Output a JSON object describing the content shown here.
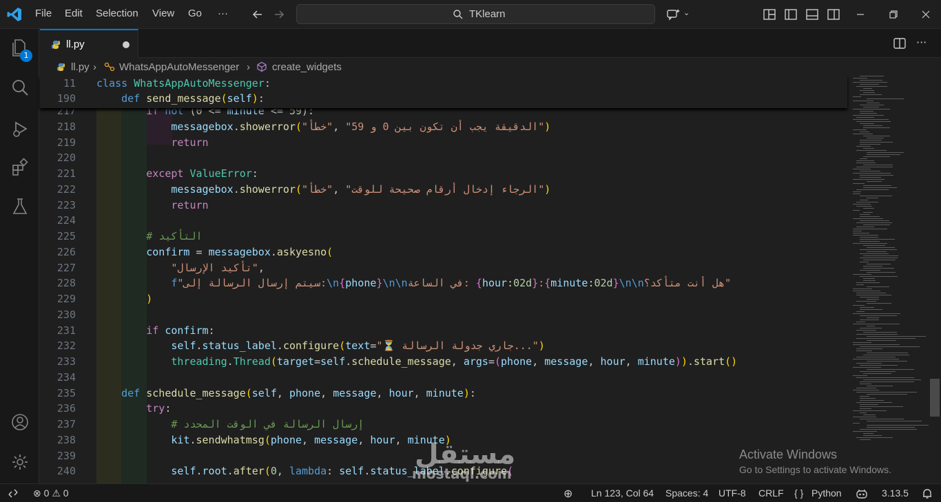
{
  "menu": [
    "File",
    "Edit",
    "Selection",
    "View",
    "Go",
    "···"
  ],
  "search": {
    "label": "TKlearn"
  },
  "activity": {
    "explorer_badge": "1"
  },
  "tab": {
    "label": "ll.py"
  },
  "breadcrumb": {
    "file": "ll.py",
    "class": "WhatsAppAutoMessenger",
    "method": "create_widgets"
  },
  "sticky": [
    {
      "ln": "11",
      "code": [
        [
          "kw",
          "class "
        ],
        [
          "cls",
          "WhatsAppAutoMessenger"
        ],
        [
          "",
          ":"
        ]
      ]
    },
    {
      "ln": "190",
      "code": [
        [
          "",
          "    "
        ],
        [
          "kw",
          "def "
        ],
        [
          "fn",
          "send_message"
        ],
        [
          "br1",
          "("
        ],
        [
          "var",
          "self"
        ],
        [
          "br1",
          ")"
        ],
        [
          "",
          ":"
        ]
      ]
    }
  ],
  "lines": [
    {
      "ln": "217",
      "code": [
        [
          "",
          "        "
        ],
        [
          "kc",
          "if "
        ],
        [
          "kw",
          "not "
        ],
        [
          "",
          "("
        ],
        [
          "num",
          "0"
        ],
        [
          "",
          " <= "
        ],
        [
          "var",
          "minute"
        ],
        [
          "",
          " <= "
        ],
        [
          "num",
          "59"
        ],
        [
          "",
          "):"
        ]
      ]
    },
    {
      "ln": "218",
      "code": [
        [
          "",
          "            "
        ],
        [
          "var",
          "messagebox"
        ],
        [
          "",
          "."
        ],
        [
          "fn",
          "showerror"
        ],
        [
          "br1",
          "("
        ],
        [
          "str",
          "\"خطأ\""
        ],
        [
          "",
          ", "
        ],
        [
          "str",
          "\"الدقيقة يجب أن تكون بين 0 و 59\""
        ],
        [
          "br1",
          ")"
        ]
      ]
    },
    {
      "ln": "219",
      "code": [
        [
          "",
          "            "
        ],
        [
          "kc",
          "return"
        ]
      ]
    },
    {
      "ln": "220",
      "code": []
    },
    {
      "ln": "221",
      "code": [
        [
          "",
          "        "
        ],
        [
          "kc",
          "except "
        ],
        [
          "cls",
          "ValueError"
        ],
        [
          "",
          ":"
        ]
      ]
    },
    {
      "ln": "222",
      "code": [
        [
          "",
          "            "
        ],
        [
          "var",
          "messagebox"
        ],
        [
          "",
          "."
        ],
        [
          "fn",
          "showerror"
        ],
        [
          "br1",
          "("
        ],
        [
          "str",
          "\"خطأ\""
        ],
        [
          "",
          ", "
        ],
        [
          "str",
          "\"الرجاء إدخال أرقام صحيحة للوقت\""
        ],
        [
          "br1",
          ")"
        ]
      ]
    },
    {
      "ln": "223",
      "code": [
        [
          "",
          "            "
        ],
        [
          "kc",
          "return"
        ]
      ]
    },
    {
      "ln": "224",
      "code": []
    },
    {
      "ln": "225",
      "code": [
        [
          "",
          "        "
        ],
        [
          "cmt",
          "# التأكيد"
        ]
      ]
    },
    {
      "ln": "226",
      "code": [
        [
          "",
          "        "
        ],
        [
          "var",
          "confirm"
        ],
        [
          "",
          " = "
        ],
        [
          "var",
          "messagebox"
        ],
        [
          "",
          "."
        ],
        [
          "fn",
          "askyesno"
        ],
        [
          "br1",
          "("
        ]
      ]
    },
    {
      "ln": "227",
      "code": [
        [
          "",
          "            "
        ],
        [
          "str",
          "\"تأكيد الإرسال\""
        ],
        [
          "",
          ","
        ]
      ]
    },
    {
      "ln": "228",
      "code": [
        [
          "",
          "            "
        ],
        [
          "kw",
          "f"
        ],
        [
          "str",
          "\"سيتم إرسال الرسالة إلى:"
        ],
        [
          "kw",
          "\\n"
        ],
        [
          "br2",
          "{"
        ],
        [
          "var",
          "phone"
        ],
        [
          "br2",
          "}"
        ],
        [
          "kw",
          "\\n\\n"
        ],
        [
          "str",
          "في الساعة: "
        ],
        [
          "br2",
          "{"
        ],
        [
          "var",
          "hour"
        ],
        [
          "",
          ":"
        ],
        [
          "num",
          "02d"
        ],
        [
          "br2",
          "}"
        ],
        [
          "str",
          ":"
        ],
        [
          "br2",
          "{"
        ],
        [
          "var",
          "minute"
        ],
        [
          "",
          ":"
        ],
        [
          "num",
          "02d"
        ],
        [
          "br2",
          "}"
        ],
        [
          "kw",
          "\\n\\n"
        ],
        [
          "str",
          "هل أنت متأكد؟\""
        ]
      ]
    },
    {
      "ln": "229",
      "code": [
        [
          "",
          "        "
        ],
        [
          "br1",
          ")"
        ]
      ]
    },
    {
      "ln": "230",
      "code": []
    },
    {
      "ln": "231",
      "code": [
        [
          "",
          "        "
        ],
        [
          "kc",
          "if "
        ],
        [
          "var",
          "confirm"
        ],
        [
          "",
          ":"
        ]
      ]
    },
    {
      "ln": "232",
      "code": [
        [
          "",
          "            "
        ],
        [
          "var",
          "self"
        ],
        [
          "",
          "."
        ],
        [
          "var",
          "status_label"
        ],
        [
          "",
          "."
        ],
        [
          "fn",
          "configure"
        ],
        [
          "br1",
          "("
        ],
        [
          "var",
          "text"
        ],
        [
          "",
          "="
        ],
        [
          "str",
          "\"⏳ جاري جدولة الرسالة...\""
        ],
        [
          "br1",
          ")"
        ]
      ]
    },
    {
      "ln": "233",
      "code": [
        [
          "",
          "            "
        ],
        [
          "cls",
          "threading"
        ],
        [
          "",
          "."
        ],
        [
          "cls",
          "Thread"
        ],
        [
          "br1",
          "("
        ],
        [
          "var",
          "target"
        ],
        [
          "",
          "="
        ],
        [
          "var",
          "self"
        ],
        [
          "",
          "."
        ],
        [
          "fn",
          "schedule_message"
        ],
        [
          "",
          ", "
        ],
        [
          "var",
          "args"
        ],
        [
          "",
          "="
        ],
        [
          "br2",
          "("
        ],
        [
          "var",
          "phone"
        ],
        [
          "",
          ", "
        ],
        [
          "var",
          "message"
        ],
        [
          "",
          ", "
        ],
        [
          "var",
          "hour"
        ],
        [
          "",
          ", "
        ],
        [
          "var",
          "minute"
        ],
        [
          "br2",
          ")"
        ],
        [
          "br1",
          ")"
        ],
        [
          "",
          "."
        ],
        [
          "fn",
          "start"
        ],
        [
          "br1",
          "()"
        ]
      ]
    },
    {
      "ln": "234",
      "code": []
    },
    {
      "ln": "235",
      "code": [
        [
          "",
          "    "
        ],
        [
          "kw",
          "def "
        ],
        [
          "fn",
          "schedule_message"
        ],
        [
          "br1",
          "("
        ],
        [
          "var",
          "self"
        ],
        [
          "",
          ", "
        ],
        [
          "var",
          "phone"
        ],
        [
          "",
          ", "
        ],
        [
          "var",
          "message"
        ],
        [
          "",
          ", "
        ],
        [
          "var",
          "hour"
        ],
        [
          "",
          ", "
        ],
        [
          "var",
          "minute"
        ],
        [
          "br1",
          ")"
        ],
        [
          "",
          ":"
        ]
      ]
    },
    {
      "ln": "236",
      "code": [
        [
          "",
          "        "
        ],
        [
          "kc",
          "try"
        ],
        [
          "",
          ":"
        ]
      ]
    },
    {
      "ln": "237",
      "code": [
        [
          "",
          "            "
        ],
        [
          "cmt",
          "# إرسال الرسالة في الوقت المحدد"
        ]
      ]
    },
    {
      "ln": "238",
      "code": [
        [
          "",
          "            "
        ],
        [
          "var",
          "kit"
        ],
        [
          "",
          "."
        ],
        [
          "fn",
          "sendwhatmsg"
        ],
        [
          "br1",
          "("
        ],
        [
          "var",
          "phone"
        ],
        [
          "",
          ", "
        ],
        [
          "var",
          "message"
        ],
        [
          "",
          ", "
        ],
        [
          "var",
          "hour"
        ],
        [
          "",
          ", "
        ],
        [
          "var",
          "minute"
        ],
        [
          "br1",
          ")"
        ]
      ]
    },
    {
      "ln": "239",
      "code": []
    },
    {
      "ln": "240",
      "code": [
        [
          "",
          "            "
        ],
        [
          "var",
          "self"
        ],
        [
          "",
          "."
        ],
        [
          "var",
          "root"
        ],
        [
          "",
          "."
        ],
        [
          "fn",
          "after"
        ],
        [
          "br1",
          "("
        ],
        [
          "num",
          "0"
        ],
        [
          "",
          ", "
        ],
        [
          "kw",
          "lambda"
        ],
        [
          "",
          ": "
        ],
        [
          "var",
          "self"
        ],
        [
          "",
          "."
        ],
        [
          "var",
          "status_label"
        ],
        [
          "",
          "."
        ],
        [
          "fn",
          "configure"
        ],
        [
          "br2",
          "("
        ]
      ]
    }
  ],
  "watermark": {
    "title": "Activate Windows",
    "subtitle": "Go to Settings to activate Windows.",
    "brand_ar": "مستقل",
    "brand_en": "mostaql.com"
  },
  "status": {
    "errors": "0",
    "warnings": "0",
    "position": "Ln 123, Col 64",
    "spaces": "Spaces: 4",
    "encoding": "UTF-8",
    "eol": "CRLF",
    "language": "Python",
    "version": "3.13.5"
  },
  "colors": {
    "accent": "#0078d4",
    "background": "#1f1f1f"
  }
}
